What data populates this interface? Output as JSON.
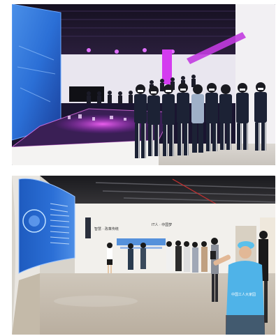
{
  "photos": [
    {
      "id": "top",
      "scene": "students-at-model-display"
    },
    {
      "id": "bottom",
      "scene": "visitors-in-gallery"
    }
  ],
  "signage": {
    "vest_text": "中国工人大家园",
    "wall_sign_left": "智慧 · 改革传统",
    "wall_sign_right": "IT人 · 中国梦"
  },
  "colors": {
    "page_bg": "#ffffff",
    "neon_magenta": "#d43cf0",
    "screen_blue": "#2b6fd6",
    "uniform_navy": "#1c2235",
    "vest_blue": "#4fb3e8"
  }
}
